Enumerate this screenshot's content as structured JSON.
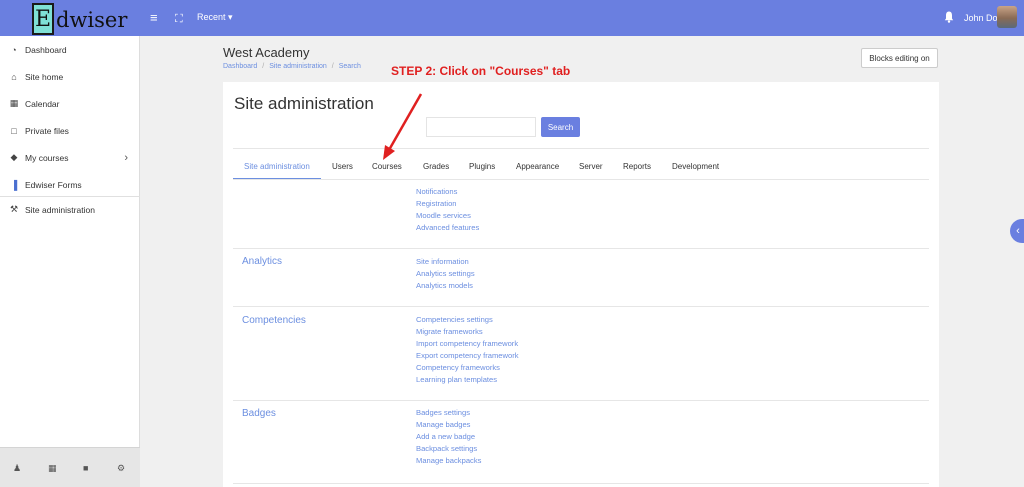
{
  "header": {
    "logo_letter": "E",
    "logo_rest": "dwiser",
    "recent_label": "Recent ▾",
    "user_name": "John Doe"
  },
  "sidebar": {
    "items": [
      {
        "icon": "dashboard-icon",
        "glyph": "◔",
        "label": "Dashboard"
      },
      {
        "icon": "home-icon",
        "glyph": "⌂",
        "label": "Site home"
      },
      {
        "icon": "calendar-icon",
        "glyph": "▦",
        "label": "Calendar"
      },
      {
        "icon": "file-icon",
        "glyph": "□",
        "label": "Private files"
      },
      {
        "icon": "graduation-cap-icon",
        "glyph": "◆",
        "label": "My courses"
      },
      {
        "icon": "forms-icon",
        "glyph": "▐",
        "label": "Edwiser Forms"
      },
      {
        "icon": "wrench-icon",
        "glyph": "⚒",
        "label": "Site administration"
      }
    ],
    "footer_icons": [
      "users-icon",
      "calendar-icon",
      "file-icon",
      "cogs-icon"
    ]
  },
  "page": {
    "site_title": "West Academy",
    "breadcrumb": [
      "Dashboard",
      "Site administration",
      "Search"
    ],
    "blocks_button": "Blocks editing on",
    "card_title": "Site administration",
    "search_button": "Search",
    "search_placeholder": ""
  },
  "tabs": [
    "Site administration",
    "Users",
    "Courses",
    "Grades",
    "Plugins",
    "Appearance",
    "Server",
    "Reports",
    "Development"
  ],
  "sections": {
    "general_links": [
      "Notifications",
      "Registration",
      "Moodle services",
      "Advanced features"
    ],
    "analytics": {
      "title": "Analytics",
      "links": [
        "Site information",
        "Analytics settings",
        "Analytics models"
      ]
    },
    "competencies": {
      "title": "Competencies",
      "links": [
        "Competencies settings",
        "Migrate frameworks",
        "Import competency framework",
        "Export competency framework",
        "Competency frameworks",
        "Learning plan templates"
      ]
    },
    "badges": {
      "title": "Badges",
      "links": [
        "Badges settings",
        "Manage badges",
        "Add a new badge",
        "Backpack settings",
        "Manage backpacks"
      ]
    }
  },
  "annotation": {
    "label": "STEP 2: Click on \"Courses\" tab",
    "color": "#e02020"
  },
  "colors": {
    "brand": "#6a7fe0",
    "link": "#6c8fe0"
  }
}
